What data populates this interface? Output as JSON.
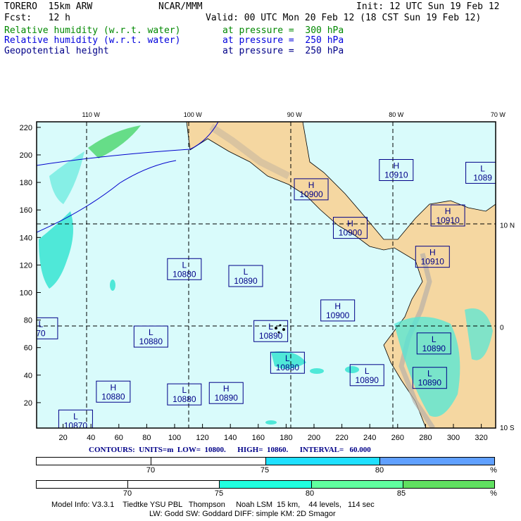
{
  "header": {
    "model": "TORERO  15km ARW",
    "org": "NCAR/MMM",
    "init": "Init: 12 UTC Sun 19 Feb 12",
    "fcst": "Fcst:   12 h",
    "valid": "Valid: 00 UTC Mon 20 Feb 12 (18 CST Sun 19 Feb 12)",
    "fields": [
      {
        "name": "Relative humidity (w.r.t. water)",
        "level": "at pressure =  300 hPa",
        "color": "#008800"
      },
      {
        "name": "Relative humidity (w.r.t. water)",
        "level": "at pressure =  250 hPa",
        "color": "#0000dd"
      },
      {
        "name": "Geopotential height",
        "level": "at pressure =  250 hPa",
        "color": "#000088"
      }
    ]
  },
  "chart_data": {
    "type": "contour-map",
    "title": "Geopotential height 250 hPa; RH 300/250 hPa",
    "x_ticks": [
      "20",
      "40",
      "60",
      "80",
      "100",
      "120",
      "140",
      "160",
      "180",
      "200",
      "220",
      "240",
      "260",
      "280",
      "300",
      "320"
    ],
    "y_ticks": [
      "220",
      "200",
      "180",
      "160",
      "140",
      "120",
      "100",
      "80",
      "60",
      "40",
      "20"
    ],
    "xlim": [
      0,
      332
    ],
    "ylim": [
      0,
      222
    ],
    "lon_labels": [
      "110 W",
      "100 W",
      "90 W",
      "80 W",
      "70 W"
    ],
    "lon_values": [
      40,
      113,
      186,
      259,
      332
    ],
    "lat_labels": [
      "10 N",
      "0",
      "10 S"
    ],
    "lat_values": [
      149,
      75,
      2
    ],
    "centers": [
      {
        "type": "L",
        "value": "10880",
        "x": 107,
        "y": 117
      },
      {
        "type": "L",
        "value": "10890",
        "x": 151,
        "y": 112
      },
      {
        "type": "L",
        "value": "10880",
        "x": 83,
        "y": 68
      },
      {
        "type": "H",
        "value": "10880",
        "x": 56,
        "y": 28
      },
      {
        "type": "L",
        "value": "10880",
        "x": 107,
        "y": 26
      },
      {
        "type": "H",
        "value": "10890",
        "x": 137,
        "y": 27
      },
      {
        "type": "L",
        "value": "10890",
        "x": 169,
        "y": 72
      },
      {
        "type": "L",
        "value": "10880",
        "x": 181,
        "y": 49
      },
      {
        "type": "H",
        "value": "10900",
        "x": 217,
        "y": 87
      },
      {
        "type": "L",
        "value": "10890",
        "x": 238,
        "y": 40
      },
      {
        "type": "H",
        "value": "10910",
        "x": 259,
        "y": 189
      },
      {
        "type": "L",
        "value": "1089",
        "x": 321,
        "y": 187
      },
      {
        "type": "H",
        "value": "10900",
        "x": 198,
        "y": 175
      },
      {
        "type": "H",
        "value": "10900",
        "x": 226,
        "y": 147
      },
      {
        "type": "H",
        "value": "10910",
        "x": 296,
        "y": 156
      },
      {
        "type": "H",
        "value": "10910",
        "x": 285,
        "y": 126
      },
      {
        "type": "L",
        "value": "10890",
        "x": 286,
        "y": 63
      },
      {
        "type": "L",
        "value": "10890",
        "x": 283,
        "y": 38
      },
      {
        "type": "L",
        "value": "10870",
        "x": 29,
        "y": 7
      },
      {
        "type": "L",
        "value": "70",
        "x": 4,
        "y": 74
      }
    ]
  },
  "contour_info": "CONTOURS:  UNITS=m  LOW=  10800.      HIGH=  10860.      INTERVAL=   60.000",
  "colorbar1": {
    "colors": [
      "#ffffff",
      "#ffffff",
      "#1fe0ff",
      "#60a0ff"
    ],
    "labels": [
      "70",
      "75",
      "80",
      "%"
    ]
  },
  "colorbar2": {
    "colors": [
      "#ffffff",
      "#ffffff",
      "#20ffdf",
      "#60ff9f",
      "#60e060"
    ],
    "labels": [
      "70",
      "75",
      "80",
      "85",
      "%"
    ]
  },
  "footer": {
    "line1": "Model Info: V3.3.1    Tiedtke YSU PBL   Thompson     Noah LSM  15 km,    44 levels,   114 sec",
    "line2": "LW: Godd SW: Goddard DIFF: simple KM: 2D Smagor"
  }
}
